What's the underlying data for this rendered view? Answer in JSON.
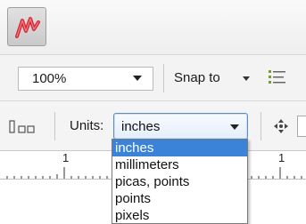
{
  "app": {
    "icon": "pen-logo-icon"
  },
  "property_bar": {
    "zoom_value": "100%",
    "snap_label": "Snap to",
    "snap_options_icon": "snap-options-icon"
  },
  "units_bar": {
    "layout_icon": "page-layout-icon",
    "units_label": "Units:",
    "units_value": "inches",
    "nudge_icon": "move-arrows-icon"
  },
  "ruler": {
    "labels": [
      "1",
      "1"
    ]
  },
  "units_dropdown": {
    "options": [
      "inches",
      "millimeters",
      "picas, points",
      "points",
      "pixels"
    ],
    "selected": "inches"
  },
  "colors": {
    "selection": "#3a83d9",
    "select_border": "#5d8bc7",
    "logo_red": "#d42a35"
  }
}
